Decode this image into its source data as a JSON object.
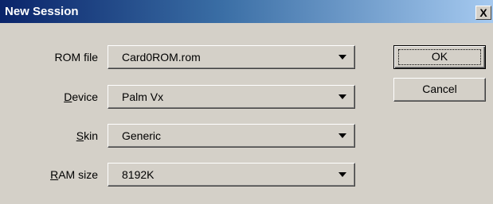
{
  "window": {
    "title": "New Session",
    "close_glyph": "X"
  },
  "fields": [
    {
      "label_accel": "",
      "label_rest": "ROM file",
      "value": "Card0ROM.rom"
    },
    {
      "label_accel": "D",
      "label_rest": "evice",
      "value": "Palm Vx"
    },
    {
      "label_accel": "S",
      "label_rest": "kin",
      "value": "Generic"
    },
    {
      "label_accel": "R",
      "label_rest": "AM size",
      "value": "8192K"
    }
  ],
  "buttons": {
    "ok": "OK",
    "cancel": "Cancel"
  },
  "icons": {
    "combo_arrow": "triangle-down-icon",
    "close": "close-icon"
  }
}
